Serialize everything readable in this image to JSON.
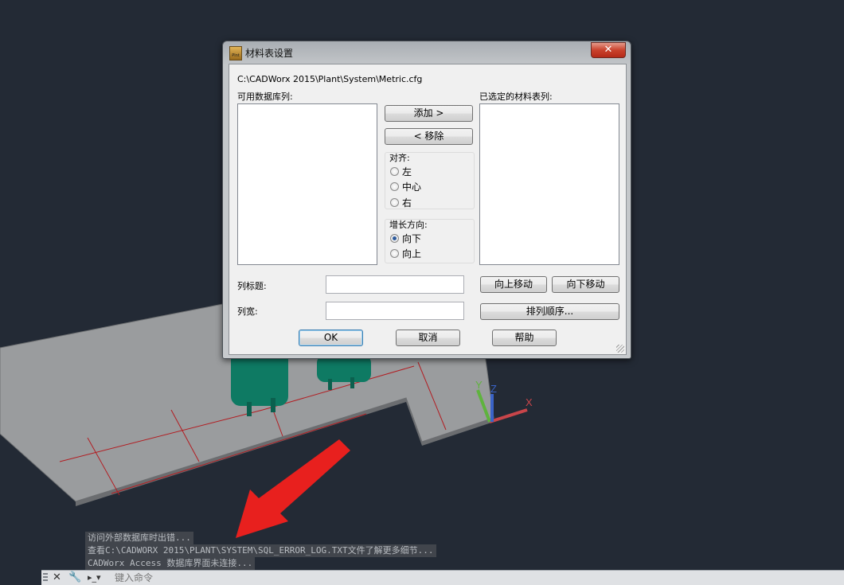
{
  "dialog": {
    "title": "材料表设置",
    "icon_text": "Plnt",
    "close_label": "✕",
    "config_path": "C:\\CADWorx 2015\\Plant\\System\\Metric.cfg",
    "available_label": "可用数据库列:",
    "selected_label": "已选定的材料表列:",
    "add_button": "添加 >",
    "remove_button": "< 移除",
    "align_group": {
      "label": "对齐:",
      "options": [
        "左",
        "中心",
        "右"
      ],
      "selected": "none"
    },
    "growth_group": {
      "label": "增长方向:",
      "options": [
        "向下",
        "向上"
      ],
      "selected": "向下"
    },
    "column_title_label": "列标题:",
    "column_title_value": "",
    "column_width_label": "列宽:",
    "column_width_value": "",
    "move_up_button": "向上移动",
    "move_down_button": "向下移动",
    "sort_order_button": "排列顺序...",
    "ok_button": "OK",
    "cancel_button": "取消",
    "help_button": "帮助"
  },
  "command_history": [
    "访问外部数据库时出错...",
    "查看C:\\CADWORX 2015\\PLANT\\SYSTEM\\SQL_ERROR_LOG.TXT文件了解更多细节...",
    "CADWorx Access 数据库界面未连接..."
  ],
  "command_line": {
    "placeholder": "键入命令"
  },
  "ucs": {
    "x": "X",
    "y": "Y",
    "z": "Z"
  },
  "colors": {
    "viewport_bg": "#232a35",
    "annotation_arrow": "#e8201e",
    "vessel": "#0e7a63"
  }
}
